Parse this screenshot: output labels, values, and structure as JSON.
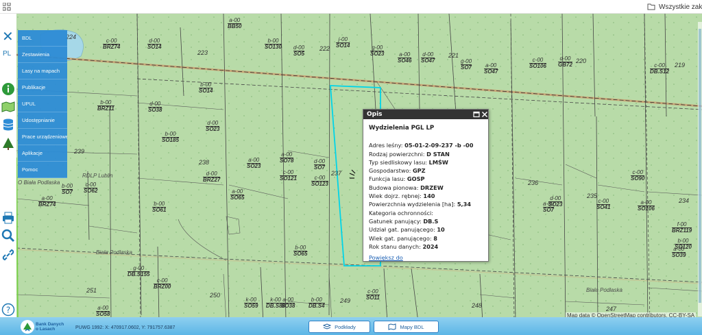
{
  "browser": {
    "bookmark_label": "Wszystkie zakład"
  },
  "rail": {
    "lang": "PL"
  },
  "menu": [
    "BDL",
    "Zestawienia",
    "Lasy na mapach",
    "Publikacje",
    "UPUL",
    "Udostępnianie",
    "Prace urządzeniowe",
    "Aplikacje",
    "Pomoc"
  ],
  "popup": {
    "header": "Opis",
    "title": "Wydzielenia PGL LP",
    "rows": [
      {
        "label": "Adres leśny: ",
        "value": "05-01-2-09-237   -b   -00"
      },
      {
        "label": "Rodzaj powierzchni: ",
        "value": "D STAN"
      },
      {
        "label": "Typ siedliskowy lasu: ",
        "value": "LMŚW"
      },
      {
        "label": "Gospodarstwo: ",
        "value": "GPZ"
      },
      {
        "label": "Funkcja lasu: ",
        "value": "GOSP"
      },
      {
        "label": "Budowa pionowa: ",
        "value": "DRZEW"
      },
      {
        "label": "Wiek dojrz. rębnej: ",
        "value": "140"
      },
      {
        "label": "Powierzchnia wydzielenia [ha]: ",
        "value": "5,34"
      },
      {
        "label": "Kategoria ochronności: ",
        "value": ""
      },
      {
        "label": "Gatunek panujący: ",
        "value": "DB.S"
      },
      {
        "label": "Udział gat. panującego: ",
        "value": "10"
      },
      {
        "label": "Wiek gat. panującego: ",
        "value": "8"
      },
      {
        "label": "Rok stanu danych: ",
        "value": "2024"
      }
    ],
    "link": "Powiększ do"
  },
  "map": {
    "parcels": [
      {
        "n": "a-00",
        "d": "BB50"
      },
      {
        "n": "c-00",
        "d": "BRZ74"
      },
      {
        "n": "d-00",
        "d": "SO14"
      },
      {
        "n": "b-00",
        "d": "SO130"
      },
      {
        "n": "d-00",
        "d": "SO5"
      },
      {
        "n": "j-00",
        "d": "SO14"
      },
      {
        "n": "g-00",
        "d": "SO23"
      },
      {
        "n": "a-00",
        "d": "SO46"
      },
      {
        "n": "d-00",
        "d": "SO47"
      },
      {
        "n": "g-00",
        "d": "SO7"
      },
      {
        "n": "c-00",
        "d": "SO106"
      },
      {
        "n": "d-00",
        "d": "GB72"
      },
      {
        "n": "c-00",
        "d": "DB.S12"
      },
      {
        "n": "a-00",
        "d": "SO47"
      },
      {
        "n": "b-00",
        "d": "BRZ11"
      },
      {
        "n": "b-00",
        "d": "SO14"
      },
      {
        "n": "d-00",
        "d": "SO38"
      },
      {
        "n": "d-00",
        "d": "SO23"
      },
      {
        "n": "b-00",
        "d": "SO185"
      },
      {
        "n": "a-00",
        "d": "SO78"
      },
      {
        "n": "d-00",
        "d": "SO7"
      },
      {
        "n": "b-00",
        "d": "SO106"
      },
      {
        "n": "d-00",
        "d": "BRZ27"
      },
      {
        "n": "a-00",
        "d": "SO23"
      },
      {
        "n": "c-00",
        "d": "SO121"
      },
      {
        "n": "c-00",
        "d": "SO123"
      },
      {
        "n": "b-00",
        "d": "SO7"
      },
      {
        "n": "a-00",
        "d": "SO65"
      },
      {
        "n": "c-00",
        "d": "SO62"
      },
      {
        "n": "b-00",
        "d": "SO61"
      },
      {
        "n": "d-00",
        "d": "SO23"
      },
      {
        "n": "c-00",
        "d": "SO41"
      },
      {
        "n": "a-00",
        "d": "SO106"
      },
      {
        "n": "f-00",
        "d": "BRZ119"
      },
      {
        "n": "b-00",
        "d": "SO65"
      },
      {
        "n": "c-00",
        "d": "BRZ00"
      },
      {
        "n": "g-00",
        "d": "DB.S155"
      },
      {
        "n": "a-00",
        "d": "SO58"
      },
      {
        "n": "k-00",
        "d": "DB.S88"
      },
      {
        "n": "k-00",
        "d": "SO59"
      },
      {
        "n": "b-00",
        "d": "DB.S4"
      },
      {
        "n": "c-00",
        "d": "SO11"
      },
      {
        "n": "a-00",
        "d": "SO38"
      },
      {
        "n": "a-00",
        "d": "SO39"
      },
      {
        "n": "c-00",
        "d": "SO90"
      },
      {
        "n": "b-00",
        "d": "SO120"
      },
      {
        "n": "a-00",
        "d": "SO7"
      },
      {
        "n": "a-00",
        "d": "BRZ74"
      }
    ],
    "numbers": [
      "224",
      "223",
      "222",
      "221",
      "220",
      "219",
      "239",
      "238",
      "237",
      "236",
      "235",
      "234",
      "251",
      "250",
      "249",
      "248",
      "247"
    ],
    "places": [
      "RDLP Lublin",
      "O Biała Podlaska",
      "Biała Podlaska"
    ]
  },
  "bottom": {
    "coords": "PUWG 1992: X: 470917.0602, Y: 791757.6387",
    "btn_podklady": "Podkłady",
    "btn_mapy": "Mapy BDL",
    "attribution": "Map data © OpenStreetMap contributors, CC-BY-SA",
    "logo": "Bank Danych o Lasach"
  },
  "colors": {
    "forest": "#b8dba8",
    "menu": "#2d8cd6",
    "highlight": "#00d4e8"
  }
}
